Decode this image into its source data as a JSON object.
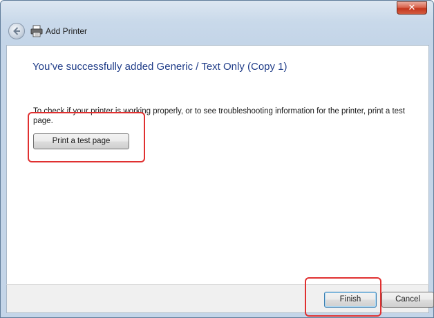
{
  "window": {
    "title": "Add Printer",
    "close_label": "✕"
  },
  "main": {
    "headline": "You’ve successfully added Generic / Text Only (Copy 1)",
    "description": "To check if your printer is working properly, or to see troubleshooting information for the printer, print a test page.",
    "print_test_label": "Print a test page"
  },
  "footer": {
    "finish_label": "Finish",
    "cancel_label": "Cancel"
  },
  "icons": {
    "back": "back-arrow-icon",
    "printer": "printer-icon"
  },
  "colors": {
    "headline": "#1f3c88",
    "highlight": "#e03030",
    "close_button": "#c4371e"
  }
}
